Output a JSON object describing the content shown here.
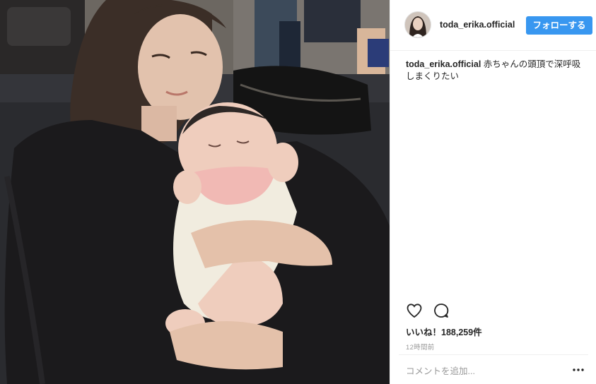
{
  "header": {
    "username": "toda_erika.official",
    "follow_label": "フォローする"
  },
  "caption": {
    "username": "toda_erika.official",
    "text": "赤ちゃんの頭頂で深呼吸しまくりたい"
  },
  "actions": {
    "icons": [
      "heart-icon",
      "comment-icon"
    ]
  },
  "likes": {
    "text": "いいね！188,259件"
  },
  "timestamp": "12時間前",
  "comment_box": {
    "placeholder": "コメントを追加...",
    "more_icon": "more-options-icon"
  },
  "colors": {
    "follow_button": "#3897f0",
    "border": "#efefef",
    "muted_text": "#999999",
    "text": "#262626"
  }
}
